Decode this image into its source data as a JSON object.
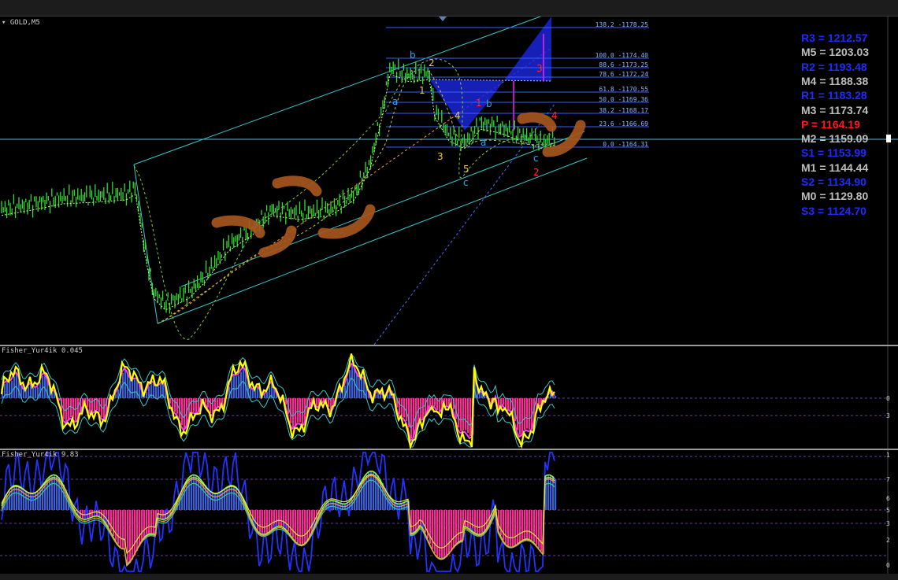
{
  "chart": {
    "symbol_label": "GOLD,M5"
  },
  "pivots": [
    {
      "text": "R3 = 1212.57",
      "color": "#1e2bff"
    },
    {
      "text": "M5 = 1203.03",
      "color": "#bdbdbd"
    },
    {
      "text": "R2 = 1193.48",
      "color": "#1e2bff"
    },
    {
      "text": "M4 = 1188.38",
      "color": "#bdbdbd"
    },
    {
      "text": "R1 = 1183.28",
      "color": "#1e2bff"
    },
    {
      "text": "M3 = 1173.74",
      "color": "#bdbdbd"
    },
    {
      "text": "P  = 1164.19",
      "color": "#ff1a1a"
    },
    {
      "text": "M2 = 1159.09",
      "color": "#bdbdbd"
    },
    {
      "text": "S1 = 1153.99",
      "color": "#1e2bff"
    },
    {
      "text": "M1 = 1144.44",
      "color": "#bdbdbd"
    },
    {
      "text": "S2 = 1134.90",
      "color": "#1e2bff"
    },
    {
      "text": "M0 = 1129.80",
      "color": "#bdbdbd"
    },
    {
      "text": "S3 = 1124.70",
      "color": "#1e2bff"
    }
  ],
  "fibonacci": [
    "138.2 -1178.25",
    "100.0 -1174.40",
    "88.6 -1173.25",
    "78.6 -1172.24",
    "61.8 -1170.55",
    "50.0 -1169.36",
    "38.2 -1168.17",
    "23.6 -1166.69",
    "0.0 -1164.31"
  ],
  "wave_labels": {
    "b_upper": "b",
    "two_yellow": "2",
    "one_yellow": "1",
    "a_upper": "a",
    "four_yellow": "4",
    "three_yellow": "3",
    "five_yellow": "5",
    "c_left": "c",
    "one_red": "1",
    "b_mid": "b",
    "a_mid": "a",
    "three_red": "3",
    "four_red": "4",
    "c_right": "c",
    "two_red": "2"
  },
  "fisher_panel": {
    "title": "Fisher_Yur4ik 0.045",
    "axis_labels": [
      "0",
      "3"
    ]
  },
  "fisher2_panel": {
    "title": "Fisher_Yur4ik 9.83",
    "axis_labels": [
      "1",
      "7",
      "6",
      "5",
      "3",
      "2",
      "0"
    ]
  },
  "colors": {
    "candles": "#33dd33",
    "channel": "#37c8c8",
    "harmonic_fill": "#1a24d6",
    "marker_brush": "#a5561f",
    "hist_pos": "#3a5fd6",
    "hist_neg": "#ff2a9a",
    "fisher_fast": "#ffff00",
    "fisher_signal": "#ff3cff",
    "fisher_band": "#38c8c8"
  }
}
